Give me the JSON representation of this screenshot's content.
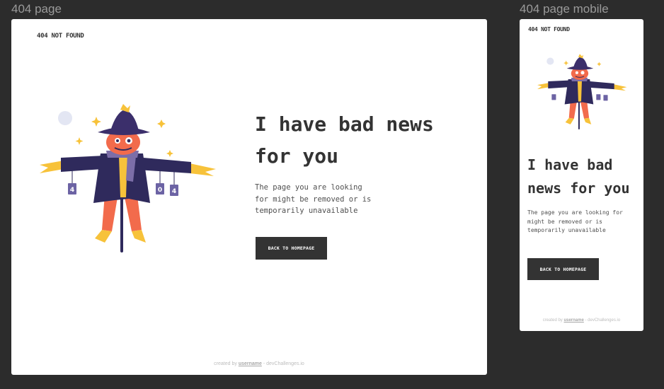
{
  "frames": {
    "desktop": {
      "label": "404 page",
      "brand": "404 NOT FOUND",
      "headline_line1": "I have bad news",
      "headline_line2": "for you",
      "desc_line1": "The page you are looking",
      "desc_line2": "for might be removed or is",
      "desc_line3": "temporarily unavailable",
      "button": "BACK TO HOMEPAGE",
      "credit_prefix": "created by ",
      "credit_user": "username",
      "credit_suffix": " - devChallenges.io"
    },
    "mobile": {
      "label": "404 page mobile",
      "brand": "404 NOT FOUND",
      "headline_line1": "I have bad",
      "headline_line2": "news for you",
      "desc_line1": "The page you are looking for",
      "desc_line2": "might be removed or is",
      "desc_line3": "temporarily unavailable",
      "button": "BACK TO HOMEPAGE",
      "credit_prefix": "created by ",
      "credit_user": "username",
      "credit_suffix": " - devChallenges.io"
    }
  },
  "illustration": {
    "tag_digits": [
      "4",
      "0",
      "4"
    ],
    "colors": {
      "hat": "#3b2f6b",
      "head": "#f26b4c",
      "coat": "#2f2a5c",
      "straw": "#f7c23a",
      "pole": "#2f2a5c",
      "scarf": "#7c6ea8",
      "tag": "#6c63a4",
      "moon": "#e3e6f3"
    }
  }
}
